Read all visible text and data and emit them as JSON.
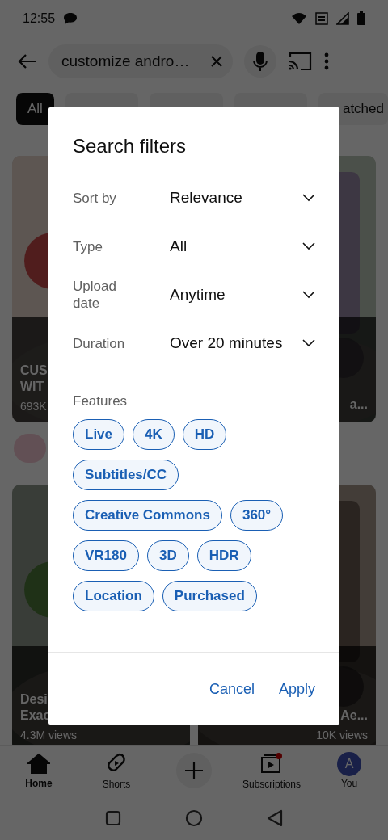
{
  "status_bar": {
    "time": "12:55"
  },
  "search": {
    "value": "customize andro…"
  },
  "chips": [
    {
      "label": "All",
      "selected": true
    },
    {
      "selected": false
    },
    {
      "selected": false
    },
    {
      "selected": false
    },
    {
      "label": "atched",
      "selected": false
    }
  ],
  "videos": [
    {
      "title": [
        "CUS",
        "WIT"
      ],
      "views": "693K"
    },
    {
      "title": [
        "a..."
      ]
    },
    {
      "title": [
        "Desi",
        "Exac"
      ],
      "views": "4.3M views"
    },
    {
      "title": [
        "Ae..."
      ],
      "views": "10K views"
    }
  ],
  "dialog": {
    "title": "Search filters",
    "filters": [
      {
        "label": "Sort by",
        "value": "Relevance"
      },
      {
        "label": "Type",
        "value": "All"
      },
      {
        "label": "Upload date",
        "value": "Anytime"
      },
      {
        "label": "Duration",
        "value": "Over 20 minutes"
      }
    ],
    "features_label": "Features",
    "features": [
      {
        "label": "Live",
        "selected": false
      },
      {
        "label": "4K",
        "selected": false
      },
      {
        "label": "HD",
        "selected": false
      },
      {
        "label": "Subtitles/CC",
        "selected": false
      },
      {
        "label": "Creative Commons",
        "selected": false
      },
      {
        "label": "360°",
        "selected": false
      },
      {
        "label": "VR180",
        "selected": false
      },
      {
        "label": "3D",
        "selected": false
      },
      {
        "label": "HDR",
        "selected": false
      },
      {
        "label": "Location",
        "selected": false
      },
      {
        "label": "Purchased",
        "selected": false
      }
    ],
    "buttons": [
      "Cancel",
      "Apply"
    ]
  },
  "bottom_nav": [
    {
      "kind": "home",
      "label": "Home",
      "selected": true
    },
    {
      "kind": "shorts",
      "label": "Shorts",
      "selected": false
    },
    {
      "kind": "create"
    },
    {
      "kind": "subscriptions",
      "label": "Subscriptions",
      "selected": false,
      "badge": true
    },
    {
      "kind": "account",
      "label": "You",
      "avatar": "A",
      "selected": false
    }
  ]
}
